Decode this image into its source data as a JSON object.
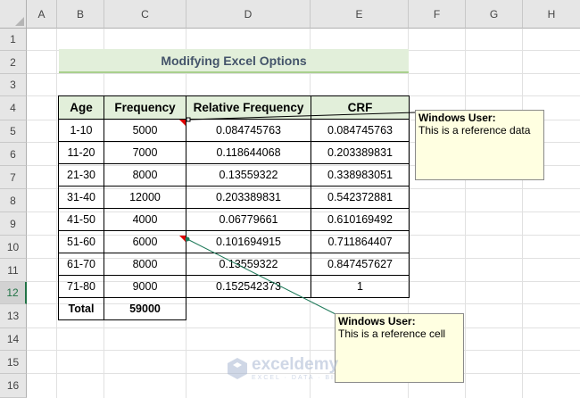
{
  "columns": [
    "A",
    "B",
    "C",
    "D",
    "E",
    "F",
    "G",
    "H"
  ],
  "rows": [
    "1",
    "2",
    "3",
    "4",
    "5",
    "6",
    "7",
    "8",
    "9",
    "10",
    "11",
    "12",
    "13",
    "14",
    "15",
    "16"
  ],
  "active_row": "12",
  "title": "Modifying Excel Options",
  "table": {
    "headers": [
      "Age",
      "Frequency",
      "Relative Frequency",
      "CRF"
    ],
    "rows": [
      [
        "1-10",
        "5000",
        "0.084745763",
        "0.084745763"
      ],
      [
        "11-20",
        "7000",
        "0.118644068",
        "0.203389831"
      ],
      [
        "21-30",
        "8000",
        "0.13559322",
        "0.338983051"
      ],
      [
        "31-40",
        "12000",
        "0.203389831",
        "0.542372881"
      ],
      [
        "41-50",
        "4000",
        "0.06779661",
        "0.610169492"
      ],
      [
        "51-60",
        "6000",
        "0.101694915",
        "0.711864407"
      ],
      [
        "61-70",
        "8000",
        "0.13559322",
        "0.847457627"
      ],
      [
        "71-80",
        "9000",
        "0.152542373",
        "1"
      ]
    ],
    "total_label": "Total",
    "total_value": "59000"
  },
  "comments": [
    {
      "author": "Windows User:",
      "text": "This is a reference data"
    },
    {
      "author": "Windows User:",
      "text": "This is a reference cell"
    }
  ],
  "watermark": {
    "name": "exceldemy",
    "tagline": "EXCEL · DATA · BI"
  },
  "colors": {
    "header_fill": "#e2efda",
    "title_text": "#44546a",
    "accent": "#217346",
    "comment_fill": "#ffffe1",
    "indicator": "#e00000"
  }
}
